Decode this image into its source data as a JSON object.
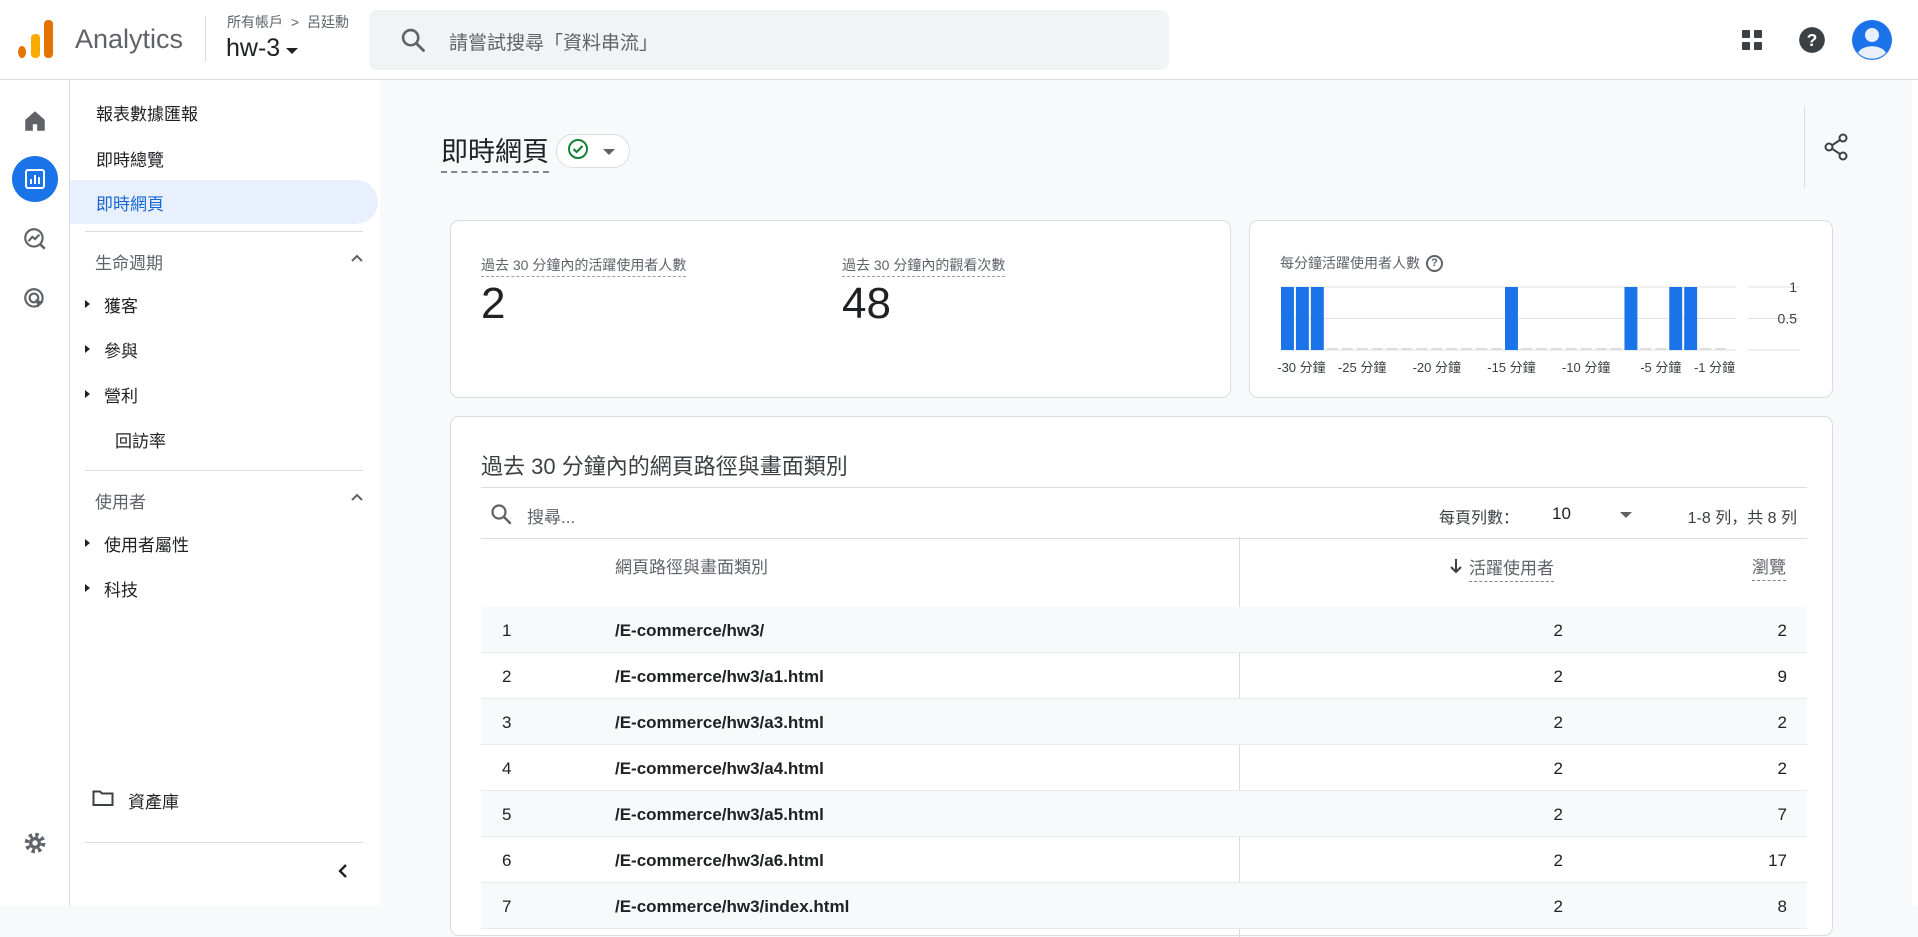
{
  "app": {
    "title": "Analytics"
  },
  "header": {
    "breadcrumb_account": "所有帳戶",
    "breadcrumb_separator": ">",
    "breadcrumb_user": "呂廷勳",
    "property": "hw-3",
    "search_placeholder": "請嘗試搜尋「資料串流」"
  },
  "sidebar": {
    "reports_header": "報表數據匯報",
    "realtime_overview": "即時總覽",
    "realtime_pages": "即時網頁",
    "lifecycle_header": "生命週期",
    "lifecycle_items": [
      "獲客",
      "參與",
      "營利",
      "回訪率"
    ],
    "user_header": "使用者",
    "user_items": [
      "使用者屬性",
      "科技"
    ],
    "library": "資產庫"
  },
  "main": {
    "title": "即時網頁",
    "kpi_active_label": "過去 30 分鐘內的活躍使用者人數",
    "kpi_active_value": "2",
    "kpi_views_label": "過去 30 分鐘內的觀看次數",
    "kpi_views_value": "48",
    "minichart_title": "每分鐘活躍使用者人數",
    "minichart_help": "?",
    "table_title": "過去 30 分鐘內的網頁路徑與畫面類別",
    "table_search_placeholder": "搜尋...",
    "rows_per_page_label": "每頁列數：",
    "rows_per_page_value": "10",
    "pagination": "1-8 列，共 8 列",
    "col_path": "網頁路徑與畫面類別",
    "col_users": "活躍使用者",
    "col_views": "瀏覽",
    "rows": [
      {
        "idx": "1",
        "path": "/E-commerce/hw3/",
        "users": "2",
        "views": "2"
      },
      {
        "idx": "2",
        "path": "/E-commerce/hw3/a1.html",
        "users": "2",
        "views": "9"
      },
      {
        "idx": "3",
        "path": "/E-commerce/hw3/a3.html",
        "users": "2",
        "views": "2"
      },
      {
        "idx": "4",
        "path": "/E-commerce/hw3/a4.html",
        "users": "2",
        "views": "2"
      },
      {
        "idx": "5",
        "path": "/E-commerce/hw3/a5.html",
        "users": "2",
        "views": "7"
      },
      {
        "idx": "6",
        "path": "/E-commerce/hw3/a6.html",
        "users": "2",
        "views": "17"
      },
      {
        "idx": "7",
        "path": "/E-commerce/hw3/index.html",
        "users": "2",
        "views": "8"
      }
    ]
  },
  "colors": {
    "accent": "#1a73e8",
    "active_bg": "#e8f0fe",
    "logo_orange": "#f9ab00",
    "logo_dark": "#e37400"
  },
  "chart_data": {
    "type": "bar",
    "title": "每分鐘活躍使用者人數",
    "x_tick_labels": [
      "-30 分鐘",
      "-25 分鐘",
      "-20 分鐘",
      "-15 分鐘",
      "-10 分鐘",
      "-5 分鐘",
      "-1 分鐘"
    ],
    "y_tick_labels": [
      "1",
      "0.5"
    ],
    "minutes_ago": [
      30,
      29,
      28,
      27,
      26,
      25,
      24,
      23,
      22,
      21,
      20,
      19,
      18,
      17,
      16,
      15,
      14,
      13,
      12,
      11,
      10,
      9,
      8,
      7,
      6,
      5,
      4,
      3,
      2,
      1
    ],
    "values": [
      1,
      1,
      1,
      0,
      0,
      0,
      0,
      0,
      0,
      0,
      0,
      0,
      0,
      0,
      0,
      1,
      0,
      0,
      0,
      0,
      0,
      0,
      0,
      1,
      0,
      0,
      1,
      1,
      0,
      0
    ],
    "ylim": [
      0,
      1
    ],
    "color": "#1a73e8"
  }
}
